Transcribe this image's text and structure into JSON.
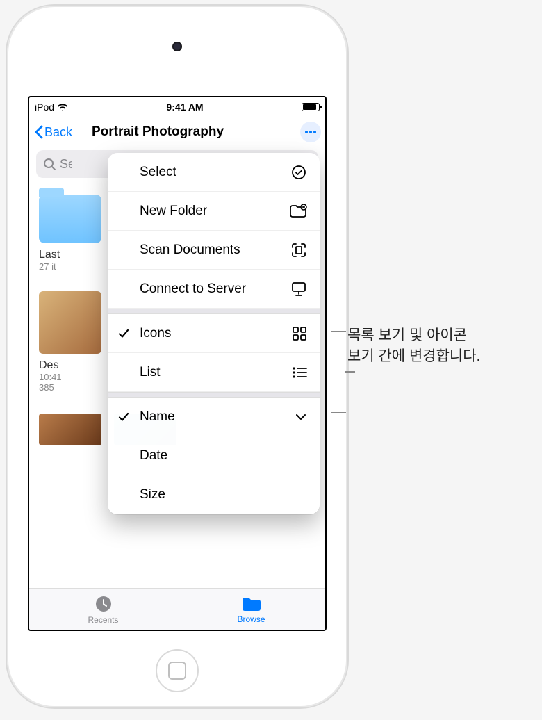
{
  "status": {
    "carrier": "iPod",
    "time": "9:41 AM"
  },
  "nav": {
    "back": "Back",
    "title": "Portrait Photography"
  },
  "search": {
    "placeholder": "Search"
  },
  "grid": {
    "folder_name": "Last",
    "folder_count": "27 it",
    "item_des": "Des",
    "item_des_time": "10:41",
    "item_des_size": "385"
  },
  "menu": {
    "group_actions": {
      "select": "Select",
      "new_folder": "New Folder",
      "scan_docs": "Scan Documents",
      "connect_server": "Connect to Server"
    },
    "group_view": {
      "icons": "Icons",
      "list": "List"
    },
    "group_sort": {
      "name": "Name",
      "date": "Date",
      "size": "Size"
    }
  },
  "tabs": {
    "recents": "Recents",
    "browse": "Browse"
  },
  "callout": {
    "line1": "목록 보기 및 아이콘",
    "line2": "보기 간에 변경합니다."
  }
}
